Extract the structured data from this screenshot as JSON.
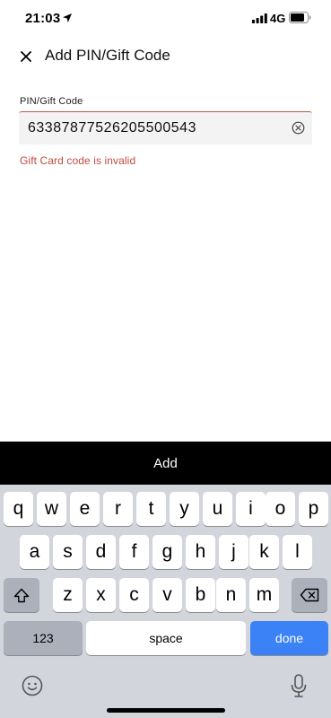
{
  "status_bar": {
    "time": "21:03",
    "network": "4G"
  },
  "header": {
    "title": "Add PIN/Gift Code"
  },
  "form": {
    "label": "PIN/Gift Code",
    "value": "6338787752620550054​3",
    "error": "Gift Card code is invalid"
  },
  "add_button": {
    "label": "Add"
  },
  "keyboard": {
    "row1": [
      "q",
      "w",
      "e",
      "r",
      "t",
      "y",
      "u",
      "i",
      "o",
      "p"
    ],
    "row2": [
      "a",
      "s",
      "d",
      "f",
      "g",
      "h",
      "j",
      "k",
      "l"
    ],
    "row3": [
      "z",
      "x",
      "c",
      "v",
      "b",
      "n",
      "m"
    ],
    "numbers_label": "123",
    "space_label": "space",
    "done_label": "done"
  },
  "colors": {
    "error": "#c0493e",
    "accent": "#3b82f6",
    "bar": "#000000"
  }
}
